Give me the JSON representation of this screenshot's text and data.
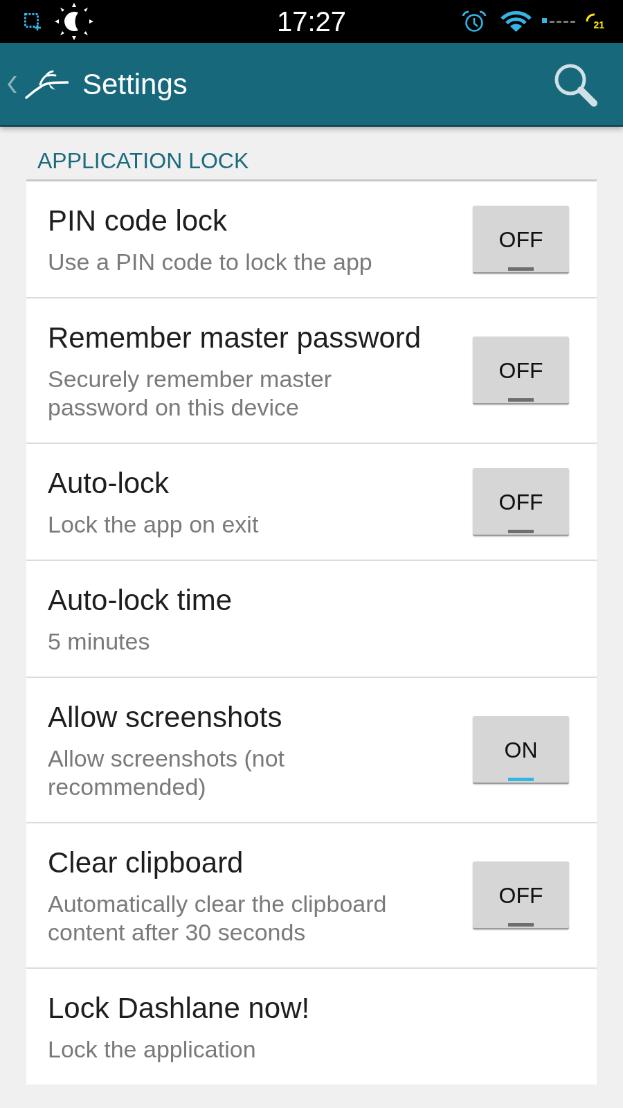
{
  "status_bar": {
    "time": "17:27",
    "indicator_text": "21"
  },
  "action_bar": {
    "title": "Settings"
  },
  "section": {
    "title": "APPLICATION LOCK",
    "items": [
      {
        "kind": "switch",
        "title": "PIN code lock",
        "summary": "Use a PIN code to lock the app",
        "switch_label": "OFF",
        "on": false
      },
      {
        "kind": "switch",
        "title": "Remember master password",
        "summary": "Securely remember master password on this device",
        "switch_label": "OFF",
        "on": false
      },
      {
        "kind": "switch",
        "title": "Auto-lock",
        "summary": "Lock the app on exit",
        "switch_label": "OFF",
        "on": false
      },
      {
        "kind": "plain",
        "title": "Auto-lock time",
        "summary": "5 minutes"
      },
      {
        "kind": "switch",
        "title": "Allow screenshots",
        "summary": "Allow screenshots (not recommended)",
        "switch_label": "ON",
        "on": true
      },
      {
        "kind": "switch",
        "title": "Clear clipboard",
        "summary": "Automatically clear the clipboard content after 30 seconds",
        "switch_label": "OFF",
        "on": false
      },
      {
        "kind": "plain",
        "title": "Lock Dashlane now!",
        "summary": "Lock the application"
      }
    ]
  }
}
